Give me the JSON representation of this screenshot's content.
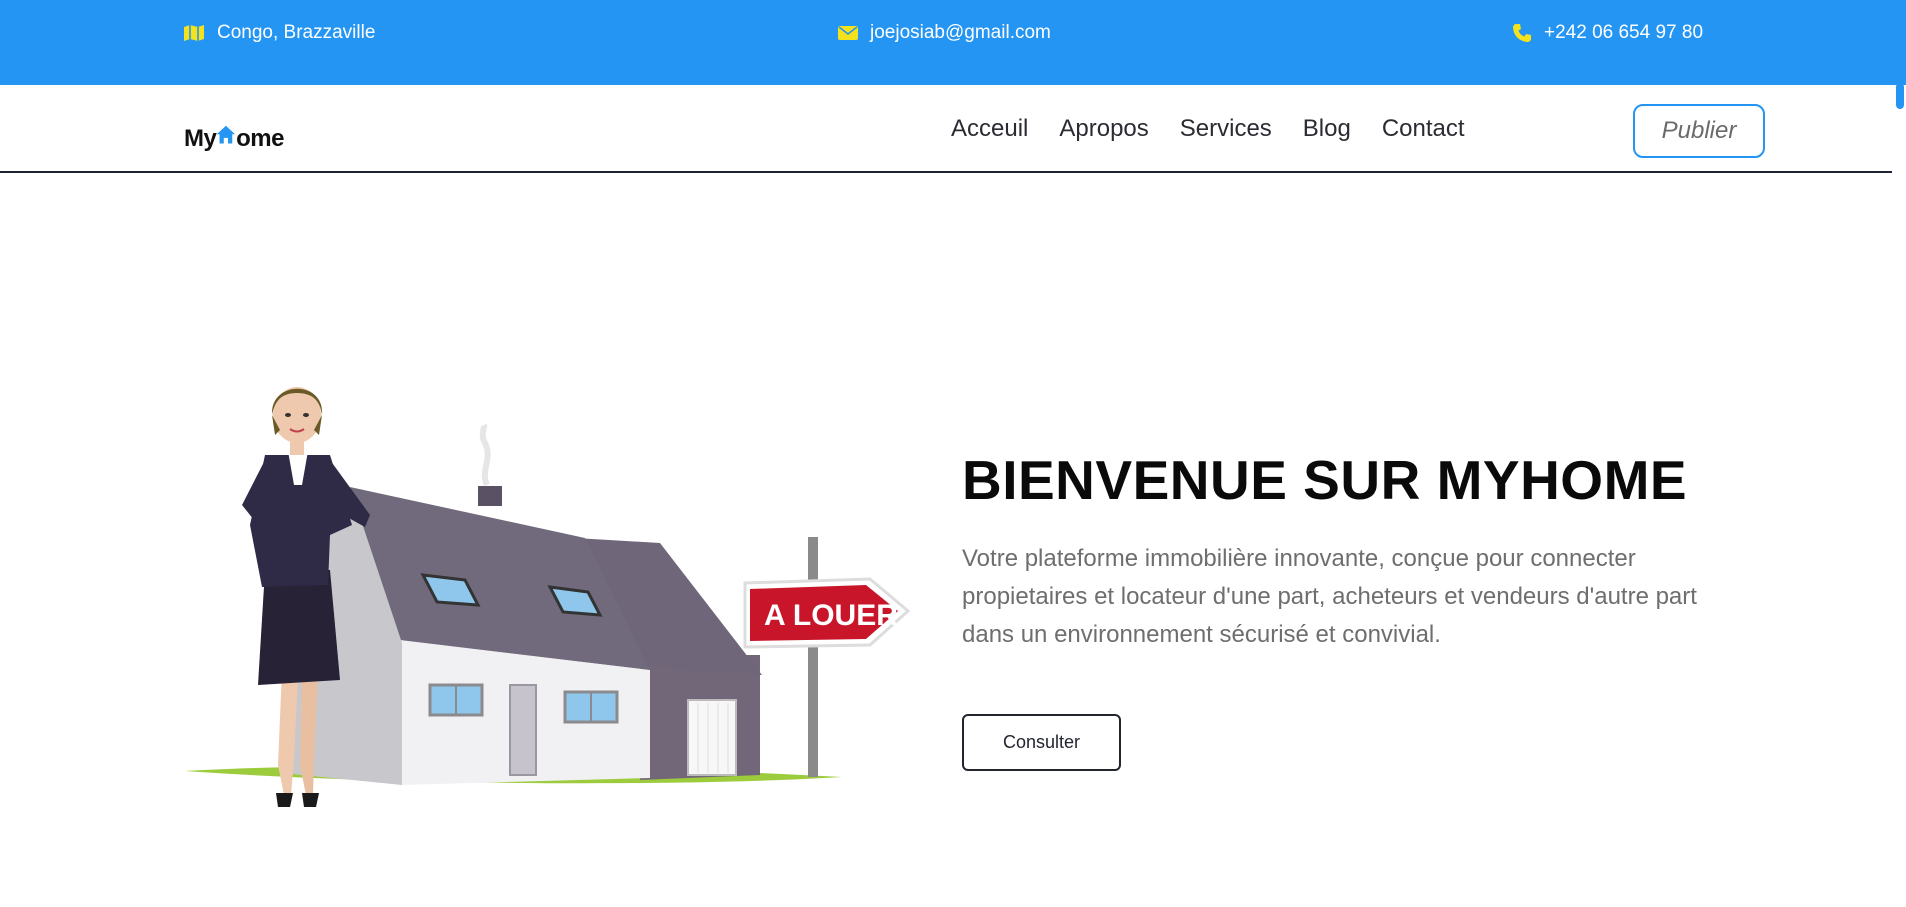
{
  "topbar": {
    "location": "Congo, Brazzaville",
    "email": "joejosiab@gmail.com",
    "phone": "+242 06 654 97 80",
    "bg_color": "#2495f3",
    "icon_color": "#f4e21c"
  },
  "navbar": {
    "logo": {
      "prefix": "My",
      "suffix": "ome",
      "icon": "house-icon"
    },
    "links": [
      "Acceuil",
      "Apropos",
      "Services",
      "Blog",
      "Contact"
    ],
    "publish_label": "Publier"
  },
  "hero": {
    "title": "BIENVENUE SUR MYHOME",
    "description": "Votre plateforme immobilière innovante, conçue pour connecter propietaires et locateur d'une part, acheteurs et vendeurs d'autre part dans un environnement sécurisé et convivial.",
    "cta_label": "Consulter",
    "sign_text": "A LOUER"
  }
}
